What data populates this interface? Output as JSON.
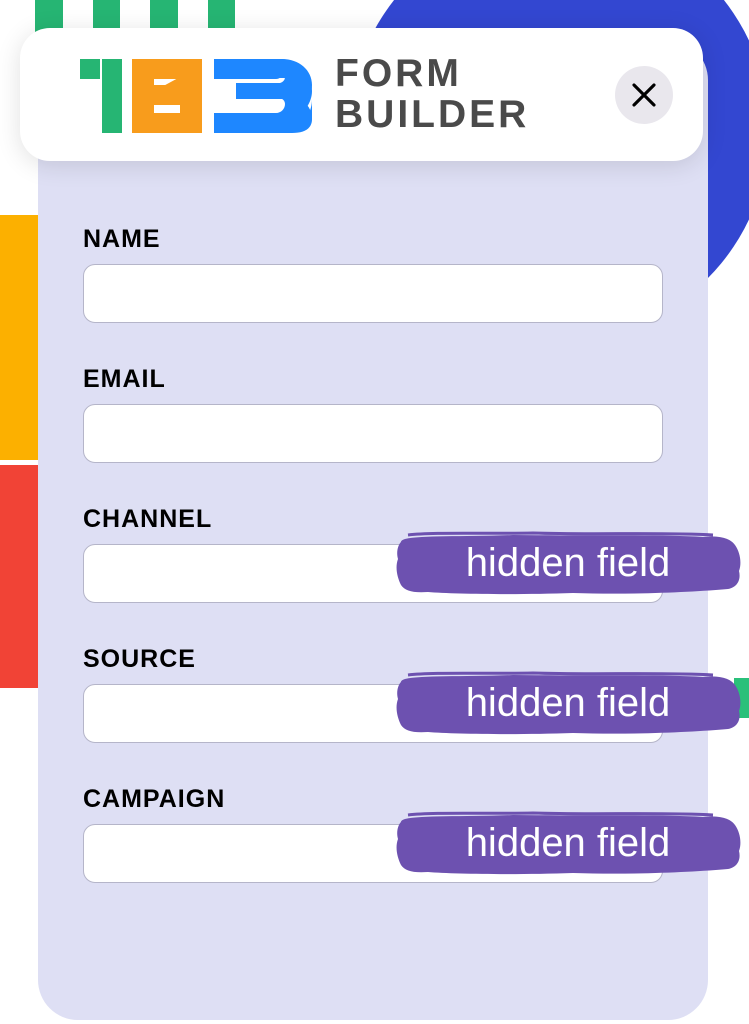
{
  "header": {
    "brand_line1": "FORM",
    "brand_line2": "BUILDER"
  },
  "fields": [
    {
      "label": "NAME",
      "hidden": false
    },
    {
      "label": "EMAIL",
      "hidden": false
    },
    {
      "label": "CHANNEL",
      "hidden": true,
      "badge": "hidden field"
    },
    {
      "label": "SOURCE",
      "hidden": true,
      "badge": "hidden field"
    },
    {
      "label": "CAMPAIGN",
      "hidden": true,
      "badge": "hidden field"
    }
  ],
  "colors": {
    "panel_bg": "#dedff4",
    "badge_purple": "#6d51b0",
    "brand_green": "#26b573",
    "brand_orange": "#f89c1c",
    "brand_blue": "#1e87ff"
  }
}
